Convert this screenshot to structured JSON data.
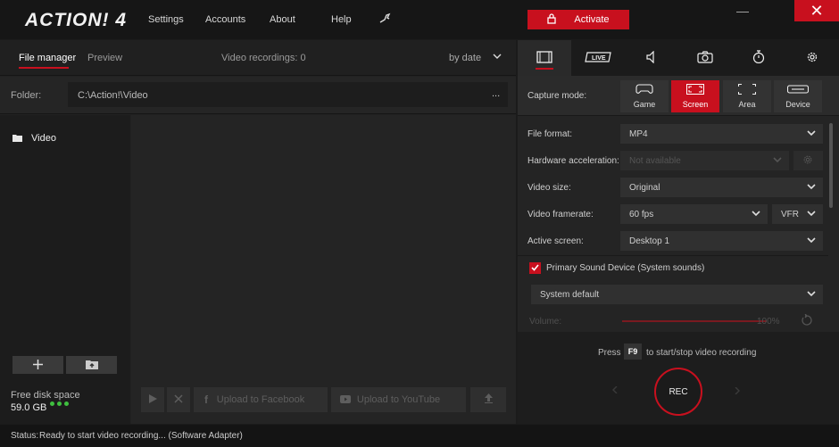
{
  "app": {
    "logo": "ACTION! 4",
    "menu": [
      "Settings",
      "Accounts",
      "About",
      "Help"
    ],
    "activate_label": "Activate",
    "minimize_glyph": "—",
    "close_glyph": "✕"
  },
  "left": {
    "tabs": [
      "File manager",
      "Preview"
    ],
    "recordings_label": "Video recordings: 0",
    "sort_label": "by date",
    "folder_label": "Folder:",
    "folder_path": "C:\\Action!\\Video",
    "folder_more": "...",
    "tree_item": "Video",
    "free_space_label": "Free disk space",
    "free_space_value": "59.0 GB",
    "upload_facebook": "Upload to Facebook",
    "upload_youtube": "Upload to YouTube"
  },
  "right": {
    "capture_mode_label": "Capture mode:",
    "capture_modes": [
      "Game",
      "Screen",
      "Area",
      "Device"
    ],
    "selected_capture_mode": "Screen",
    "fields": {
      "file_format_label": "File format:",
      "file_format_value": "MP4",
      "hw_accel_label": "Hardware acceleration:",
      "hw_accel_value": "Not available",
      "video_size_label": "Video size:",
      "video_size_value": "Original",
      "framerate_label": "Video framerate:",
      "framerate_value": "60 fps",
      "framerate_mode": "VFR",
      "active_screen_label": "Active screen:",
      "active_screen_value": "Desktop 1"
    },
    "sound_checkbox_label": "Primary Sound Device (System sounds)",
    "sound_checked": true,
    "sound_device": "System default",
    "volume_label": "Volume:",
    "volume_value": "100%",
    "volume_level": 1.0,
    "press_label": "Press",
    "hotkey": "F9",
    "hotkey_hint": "to start/stop video recording",
    "rec_label": "REC"
  },
  "status": {
    "label": "Status:",
    "text": "Ready to start video recording... (Software Adapter)"
  },
  "colors": {
    "accent": "#c8101e",
    "background": "#1b1b1b",
    "panel": "#242424",
    "free_space_dots": "#3fbf3f"
  }
}
